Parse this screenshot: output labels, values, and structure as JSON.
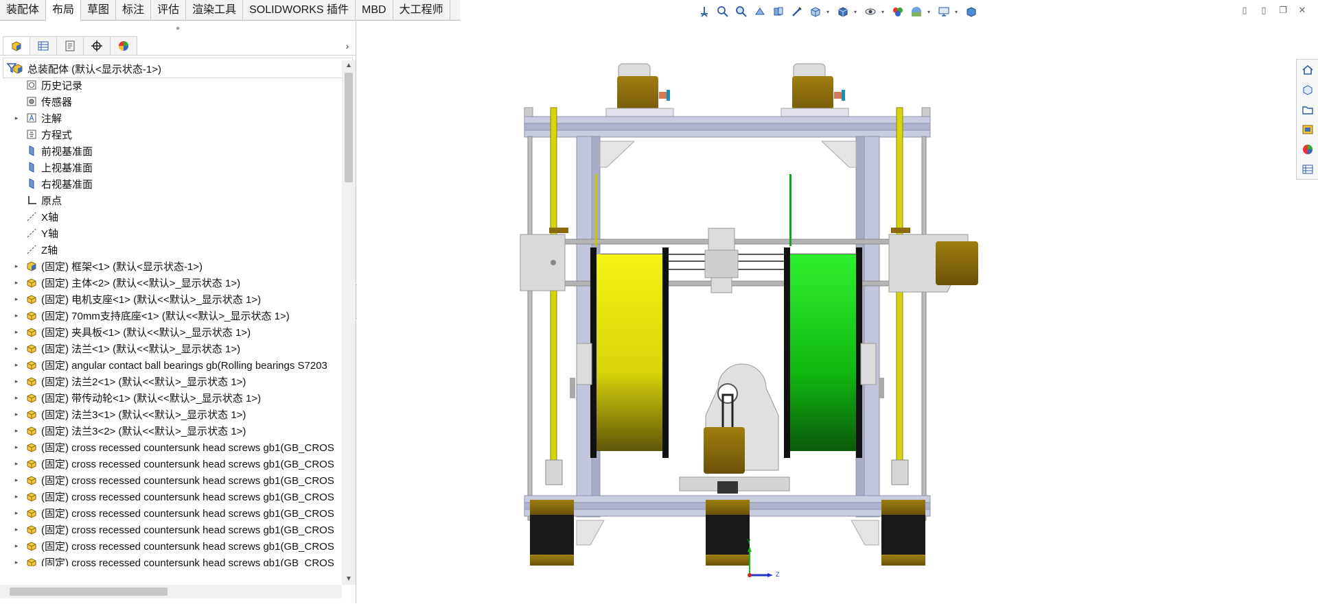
{
  "tabs": [
    {
      "label": "装配体",
      "active": false
    },
    {
      "label": "布局",
      "active": true
    },
    {
      "label": "草图",
      "active": false
    },
    {
      "label": "标注",
      "active": false
    },
    {
      "label": "评估",
      "active": false
    },
    {
      "label": "渲染工具",
      "active": false
    },
    {
      "label": "SOLIDWORKS 插件",
      "active": false
    },
    {
      "label": "MBD",
      "active": false
    },
    {
      "label": "大工程师",
      "active": false
    }
  ],
  "hud_icons": [
    "view-orientation",
    "zoom-to-fit",
    "zoom-to-area",
    "previous-view",
    "section-view",
    "dynamic-annotation",
    "view-orientation-cube",
    "display-style",
    "hide-show-items",
    "edit-appearance",
    "apply-scene",
    "view-settings",
    "3d-view"
  ],
  "tree": [
    {
      "label": "总装配体  (默认<显示状态-1>)",
      "icon": "assembly",
      "expander": "",
      "indent": 0
    },
    {
      "label": "历史记录",
      "icon": "history",
      "expander": "",
      "indent": 1
    },
    {
      "label": "传感器",
      "icon": "sensor",
      "expander": "",
      "indent": 1
    },
    {
      "label": "注解",
      "icon": "annotation",
      "expander": "▸",
      "indent": 1
    },
    {
      "label": "方程式",
      "icon": "equation",
      "expander": "",
      "indent": 1
    },
    {
      "label": "前视基准面",
      "icon": "plane",
      "expander": "",
      "indent": 1
    },
    {
      "label": "上视基准面",
      "icon": "plane",
      "expander": "",
      "indent": 1
    },
    {
      "label": "右视基准面",
      "icon": "plane",
      "expander": "",
      "indent": 1
    },
    {
      "label": "原点",
      "icon": "origin",
      "expander": "",
      "indent": 1
    },
    {
      "label": "X轴",
      "icon": "axis",
      "expander": "",
      "indent": 1
    },
    {
      "label": "Y轴",
      "icon": "axis",
      "expander": "",
      "indent": 1
    },
    {
      "label": "Z轴",
      "icon": "axis",
      "expander": "",
      "indent": 1
    },
    {
      "label": "(固定) 框架<1> (默认<显示状态-1>)",
      "icon": "subassembly",
      "expander": "▸",
      "indent": 1
    },
    {
      "label": "(固定) 主体<2> (默认<<默认>_显示状态 1>)",
      "icon": "part",
      "expander": "▸",
      "indent": 1
    },
    {
      "label": "(固定) 电机支座<1> (默认<<默认>_显示状态 1>)",
      "icon": "part",
      "expander": "▸",
      "indent": 1
    },
    {
      "label": "(固定) 70mm支持底座<1> (默认<<默认>_显示状态 1>)",
      "icon": "part",
      "expander": "▸",
      "indent": 1
    },
    {
      "label": "(固定) 夹具板<1> (默认<<默认>_显示状态 1>)",
      "icon": "part",
      "expander": "▸",
      "indent": 1
    },
    {
      "label": "(固定) 法兰<1> (默认<<默认>_显示状态 1>)",
      "icon": "part",
      "expander": "▸",
      "indent": 1
    },
    {
      "label": "(固定) angular contact ball bearings gb(Rolling bearings S7203",
      "icon": "part",
      "expander": "▸",
      "indent": 1
    },
    {
      "label": "(固定) 法兰2<1> (默认<<默认>_显示状态 1>)",
      "icon": "part",
      "expander": "▸",
      "indent": 1
    },
    {
      "label": "(固定) 带传动轮<1> (默认<<默认>_显示状态 1>)",
      "icon": "part",
      "expander": "▸",
      "indent": 1
    },
    {
      "label": "(固定) 法兰3<1> (默认<<默认>_显示状态 1>)",
      "icon": "part",
      "expander": "▸",
      "indent": 1
    },
    {
      "label": "(固定) 法兰3<2> (默认<<默认>_显示状态 1>)",
      "icon": "part",
      "expander": "▸",
      "indent": 1
    },
    {
      "label": "(固定) cross recessed countersunk head screws gb1(GB_CROS",
      "icon": "part",
      "expander": "▸",
      "indent": 1
    },
    {
      "label": "(固定) cross recessed countersunk head screws gb1(GB_CROS",
      "icon": "part",
      "expander": "▸",
      "indent": 1
    },
    {
      "label": "(固定) cross recessed countersunk head screws gb1(GB_CROS",
      "icon": "part",
      "expander": "▸",
      "indent": 1
    },
    {
      "label": "(固定) cross recessed countersunk head screws gb1(GB_CROS",
      "icon": "part",
      "expander": "▸",
      "indent": 1
    },
    {
      "label": "(固定) cross recessed countersunk head screws gb1(GB_CROS",
      "icon": "part",
      "expander": "▸",
      "indent": 1
    },
    {
      "label": "(固定) cross recessed countersunk head screws gb1(GB_CROS",
      "icon": "part",
      "expander": "▸",
      "indent": 1
    },
    {
      "label": "(固定) cross recessed countersunk head screws gb1(GB_CROS",
      "icon": "part",
      "expander": "▸",
      "indent": 1
    },
    {
      "label": "(固定) cross recessed countersunk head screws gb1(GB_CROS",
      "icon": "part",
      "expander": "▸",
      "indent": 1
    }
  ],
  "triad": {
    "y_label": "Y",
    "z_label": "Z"
  },
  "colors": {
    "frame": "#b9bdd6",
    "spool_left": "#e6e60a",
    "spool_right": "#1fd11f",
    "motor": "#8a6a0a",
    "axis_y": "#1cb51c",
    "axis_z": "#2233cc"
  },
  "taskpane_icons": [
    "home-icon",
    "resources-icon",
    "file-explorer-icon",
    "view-palette-icon",
    "appearances-icon",
    "custom-properties-icon"
  ]
}
